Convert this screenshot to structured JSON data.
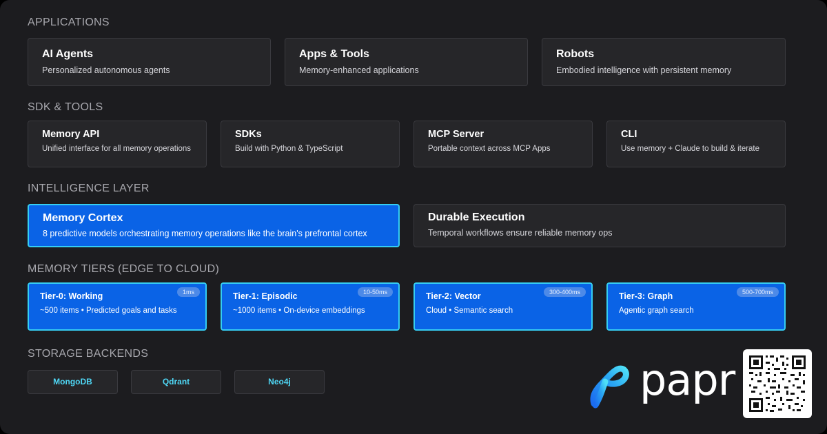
{
  "sections": {
    "applications": "APPLICATIONS",
    "sdk_tools": "SDK & TOOLS",
    "intelligence": "INTELLIGENCE LAYER",
    "tiers": "MEMORY TIERS (EDGE TO CLOUD)",
    "storage": "STORAGE BACKENDS"
  },
  "applications": [
    {
      "title": "AI Agents",
      "desc": "Personalized autonomous agents"
    },
    {
      "title": "Apps & Tools",
      "desc": "Memory-enhanced applications"
    },
    {
      "title": "Robots",
      "desc": "Embodied intelligence with persistent memory"
    }
  ],
  "sdk": [
    {
      "title": "Memory API",
      "desc": "Unified interface for all memory operations"
    },
    {
      "title": "SDKs",
      "desc": "Build with Python & TypeScript"
    },
    {
      "title": "MCP Server",
      "desc": "Portable context across MCP Apps"
    },
    {
      "title": "CLI",
      "desc": "Use memory + Claude to build & iterate"
    }
  ],
  "intelligence": [
    {
      "title": "Memory Cortex",
      "desc": "8 predictive models orchestrating memory operations like the brain's prefrontal cortex"
    },
    {
      "title": "Durable Execution",
      "desc": "Temporal workflows ensure reliable memory ops"
    }
  ],
  "tiers": [
    {
      "title": "Tier-0: Working",
      "desc": "~500 items • Predicted goals and tasks",
      "latency": "1ms"
    },
    {
      "title": "Tier-1: Episodic",
      "desc": "~1000 items • On-device embeddings",
      "latency": "10-50ms"
    },
    {
      "title": "Tier-2: Vector",
      "desc": "Cloud • Semantic search",
      "latency": "300-400ms"
    },
    {
      "title": "Tier-3: Graph",
      "desc": "Agentic graph search",
      "latency": "500-700ms"
    }
  ],
  "storage": [
    "MongoDB",
    "Qdrant",
    "Neo4j"
  ],
  "brand": {
    "name": "papr"
  },
  "colors": {
    "background": "#1c1c1f",
    "card": "#262629",
    "highlight": "#0a63e6",
    "highlight_border": "#35cdf2",
    "storage_text": "#4fd7f5"
  },
  "icons": [
    "papr-logo-icon",
    "qr-code"
  ]
}
